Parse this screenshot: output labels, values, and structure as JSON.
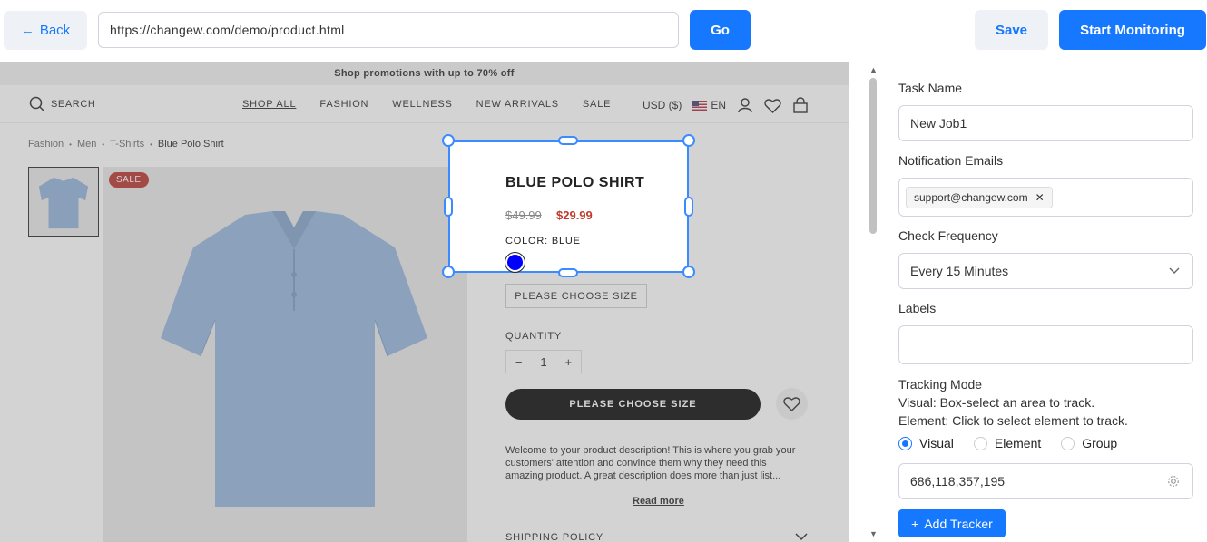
{
  "toolbar": {
    "back_label": "Back",
    "url_value": "https://changew.com/demo/product.html",
    "go_label": "Go",
    "save_label": "Save",
    "start_label": "Start Monitoring"
  },
  "preview": {
    "promo": "Shop promotions with up to 70% off",
    "nav": {
      "search_label": "SEARCH",
      "menu": [
        "SHOP ALL",
        "FASHION",
        "WELLNESS",
        "NEW ARRIVALS",
        "SALE"
      ],
      "currency": "USD ($)",
      "language": "EN"
    },
    "breadcrumb": [
      "Fashion",
      "Men",
      "T-Shirts",
      "Blue Polo Shirt"
    ],
    "sale_badge": "SALE",
    "product": {
      "title": "BLUE POLO SHIRT",
      "old_price": "$49.99",
      "new_price": "$29.99",
      "color_label": "COLOR: BLUE",
      "swatch_color": "#0000ff",
      "size_button": "PLEASE CHOOSE SIZE",
      "quantity_label": "QUANTITY",
      "quantity_value": "1",
      "quantity_minus": "−",
      "quantity_plus": "+",
      "choose_button": "PLEASE CHOOSE SIZE",
      "description": "Welcome to your product description! This is where you grab your customers' attention and convince them why they need this amazing product. A great description does more than just list...",
      "read_more": "Read more",
      "shipping_policy": "SHIPPING POLICY"
    }
  },
  "panel": {
    "task_name_label": "Task Name",
    "task_name_value": "New Job1",
    "notification_label": "Notification Emails",
    "email_tag": "support@changew.com",
    "frequency_label": "Check Frequency",
    "frequency_value": "Every 15 Minutes",
    "labels_label": "Labels",
    "labels_value": "",
    "tracking_label": "Tracking Mode",
    "help_visual_key": "Visual:",
    "help_visual_text": "Box-select an area to track.",
    "help_element_key": "Element:",
    "help_element_text": "Click to select element to track.",
    "modes": [
      "Visual",
      "Element",
      "Group"
    ],
    "selected_mode": "Visual",
    "coords_value": "686,118,357,195",
    "add_tracker_label": "Add Tracker"
  },
  "colors": {
    "accent": "#1677ff",
    "secondary_button": "#eef2f7",
    "selection_border": "#3a8bff",
    "sale_badge": "#b52b27",
    "sale_price": "#c0392b"
  }
}
